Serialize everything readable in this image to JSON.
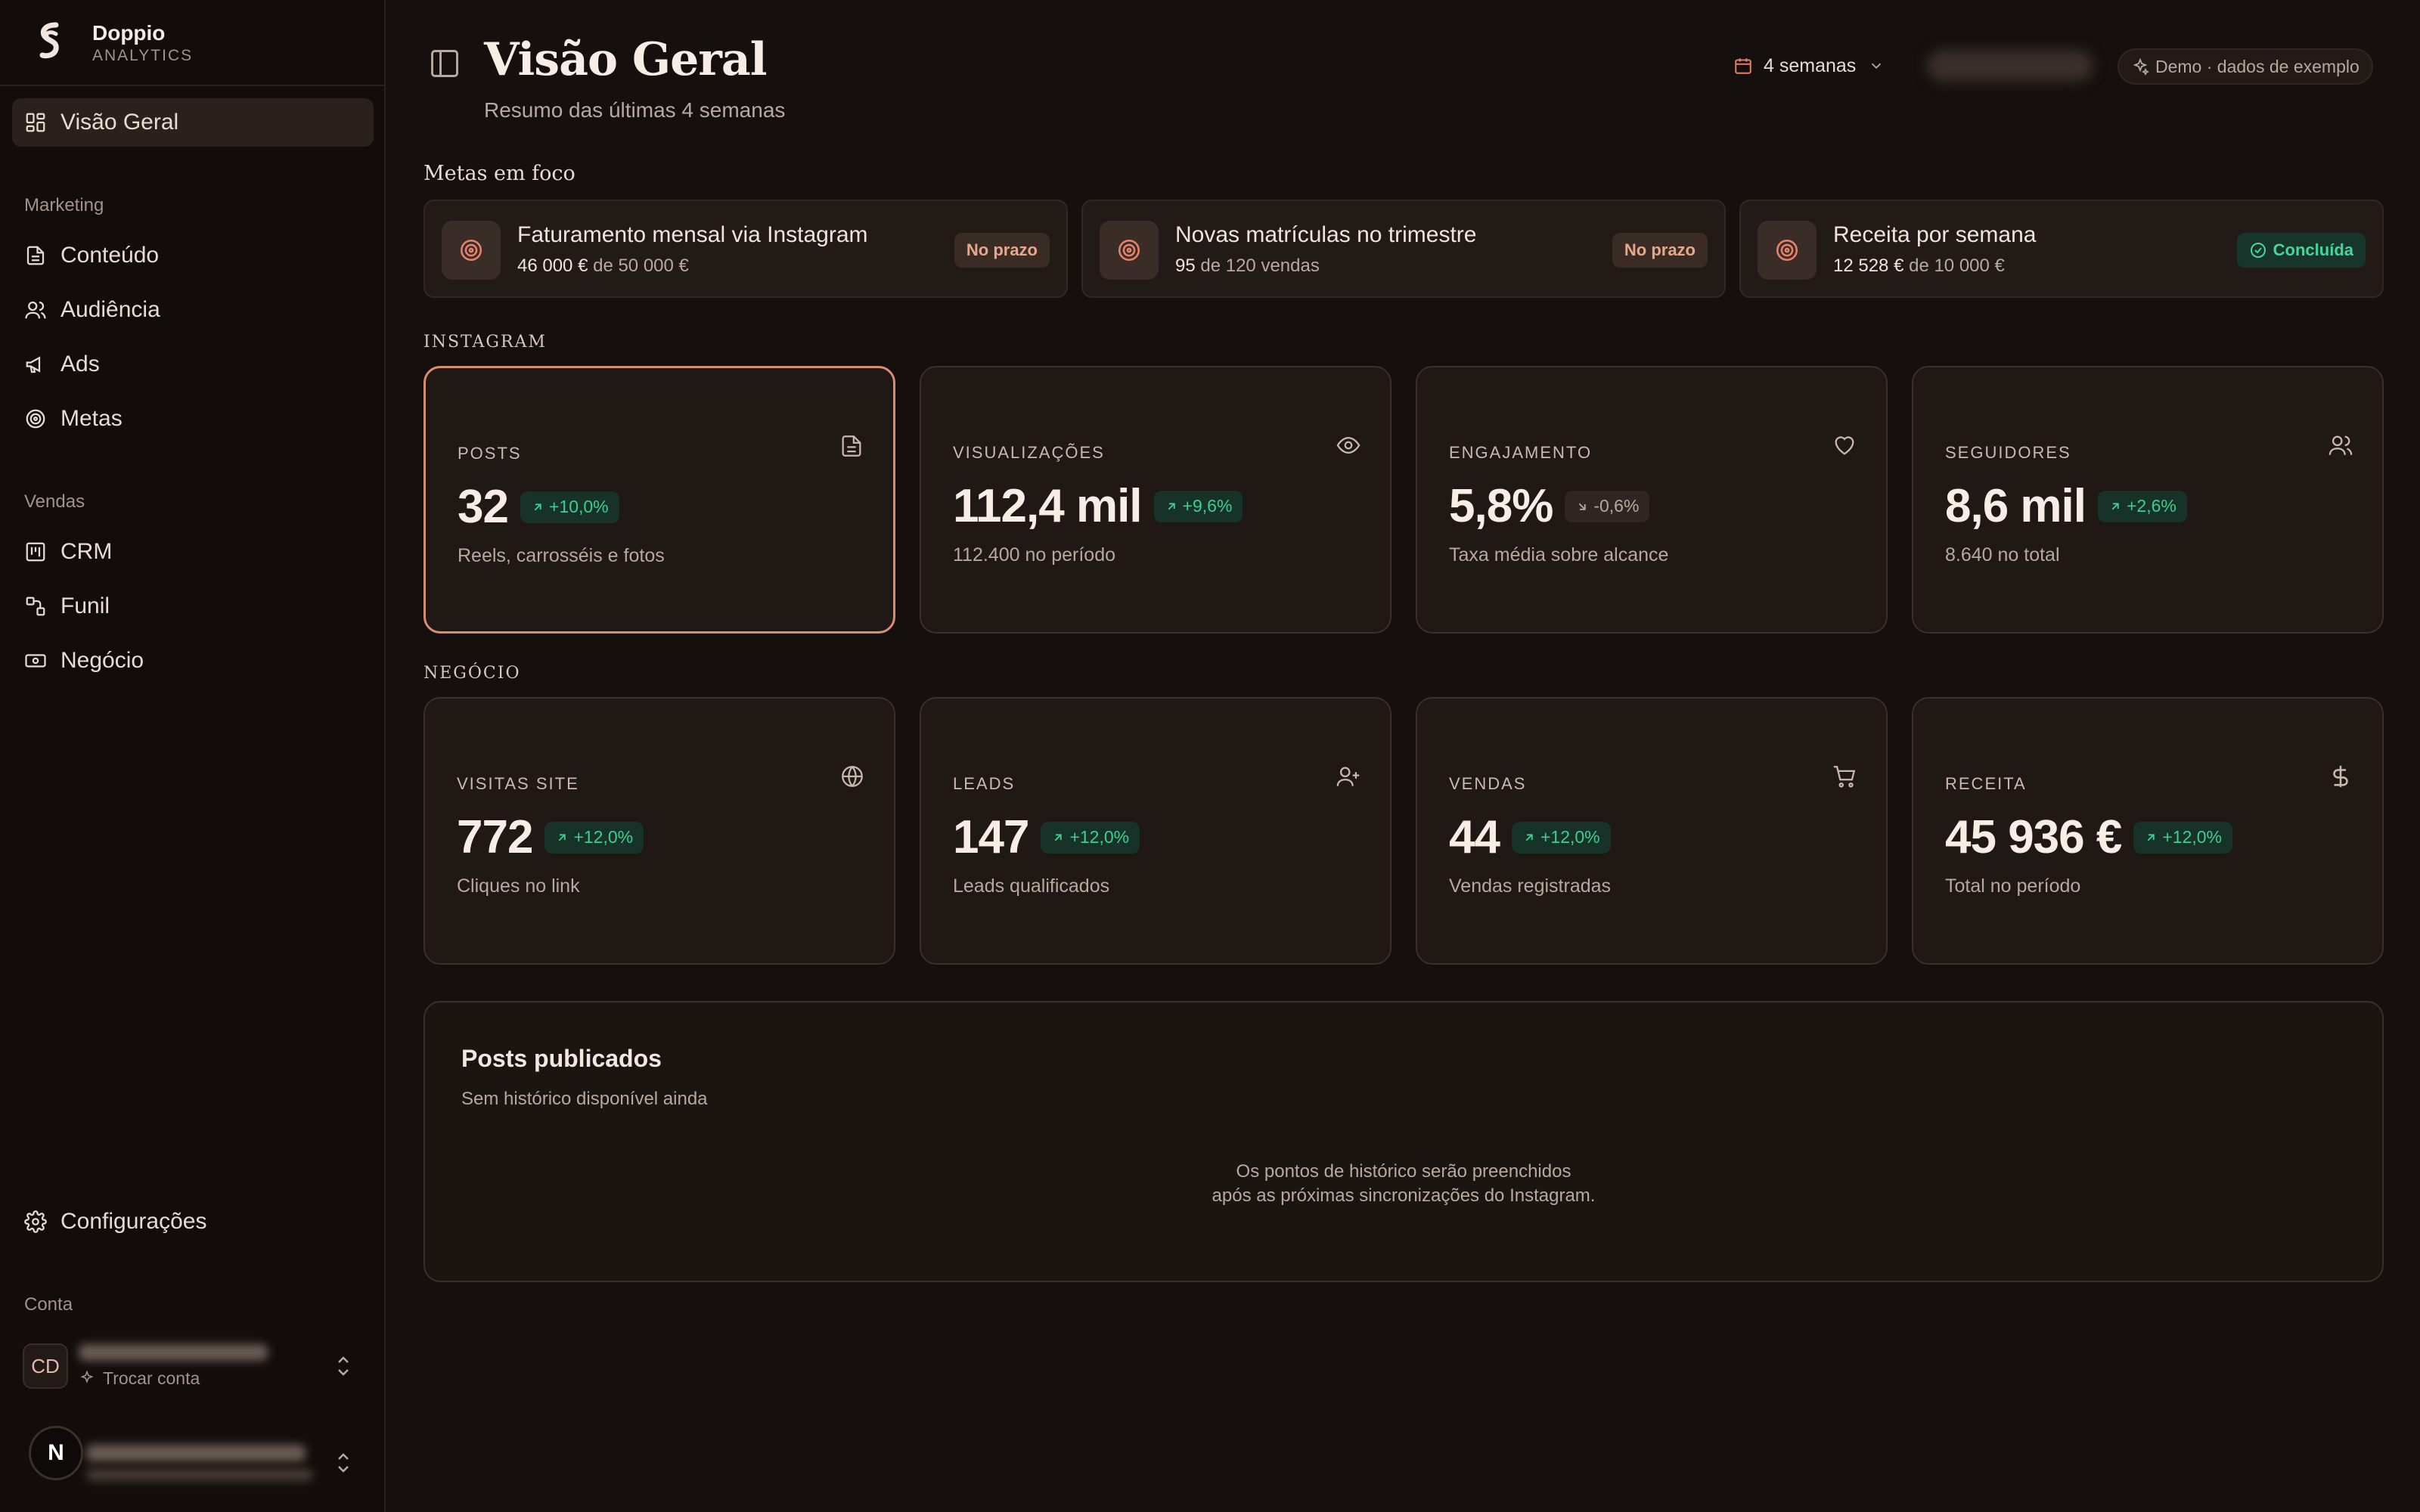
{
  "brand": {
    "name": "Doppio",
    "sub": "ANALYTICS"
  },
  "nav": {
    "overview": "Visão Geral",
    "group_marketing": "Marketing",
    "content": "Conteúdo",
    "audience": "Audiência",
    "ads": "Ads",
    "goals": "Metas",
    "group_sales": "Vendas",
    "crm": "CRM",
    "funnel": "Funil",
    "business": "Negócio",
    "settings": "Configurações",
    "group_account": "Conta"
  },
  "account": {
    "avatar": "CD",
    "switch_label": "Trocar conta",
    "fab_letter": "N"
  },
  "header": {
    "title": "Visão Geral",
    "subtitle": "Resumo das últimas 4 semanas",
    "period": "4 semanas",
    "demo": "Demo · dados de exemplo"
  },
  "goals": {
    "title": "Metas em foco",
    "items": [
      {
        "name": "Faturamento mensal via Instagram",
        "current": "46 000 €",
        "target": "de 50 000 €",
        "status": "No prazo"
      },
      {
        "name": "Novas matrículas no trimestre",
        "current": "95",
        "target": "de 120 vendas",
        "status": "No prazo"
      },
      {
        "name": "Receita por semana",
        "current": "12 528 €",
        "target": "de 10 000 €",
        "status": "Concluída"
      }
    ]
  },
  "instagram": {
    "caption": "INSTAGRAM",
    "kpis": [
      {
        "label": "POSTS",
        "value": "32",
        "delta": "+10,0%",
        "sub": "Reels, carrosséis e fotos",
        "icon": "document-icon"
      },
      {
        "label": "VISUALIZAÇÕES",
        "value": "112,4 mil",
        "delta": "+9,6%",
        "sub": "112.400 no período",
        "icon": "eye-icon"
      },
      {
        "label": "ENGAJAMENTO",
        "value": "5,8%",
        "delta": "-0,6%",
        "sub": "Taxa média sobre alcance",
        "icon": "heart-icon"
      },
      {
        "label": "SEGUIDORES",
        "value": "8,6 mil",
        "delta": "+2,6%",
        "sub": "8.640 no total",
        "icon": "users-icon"
      }
    ]
  },
  "business": {
    "caption": "NEGÓCIO",
    "kpis": [
      {
        "label": "VISITAS SITE",
        "value": "772",
        "delta": "+12,0%",
        "sub": "Cliques no link",
        "icon": "globe-icon"
      },
      {
        "label": "LEADS",
        "value": "147",
        "delta": "+12,0%",
        "sub": "Leads qualificados",
        "icon": "user-plus-icon"
      },
      {
        "label": "VENDAS",
        "value": "44",
        "delta": "+12,0%",
        "sub": "Vendas registradas",
        "icon": "cart-icon"
      },
      {
        "label": "RECEITA",
        "value": "45 936 €",
        "delta": "+12,0%",
        "sub": "Total no período",
        "icon": "dollar-icon"
      }
    ]
  },
  "posts": {
    "title": "Posts publicados",
    "subtitle": "Sem histórico disponível ainda",
    "empty_line1": "Os pontos de histórico serão preenchidos",
    "empty_line2": "após as próximas sincronizações do Instagram."
  }
}
